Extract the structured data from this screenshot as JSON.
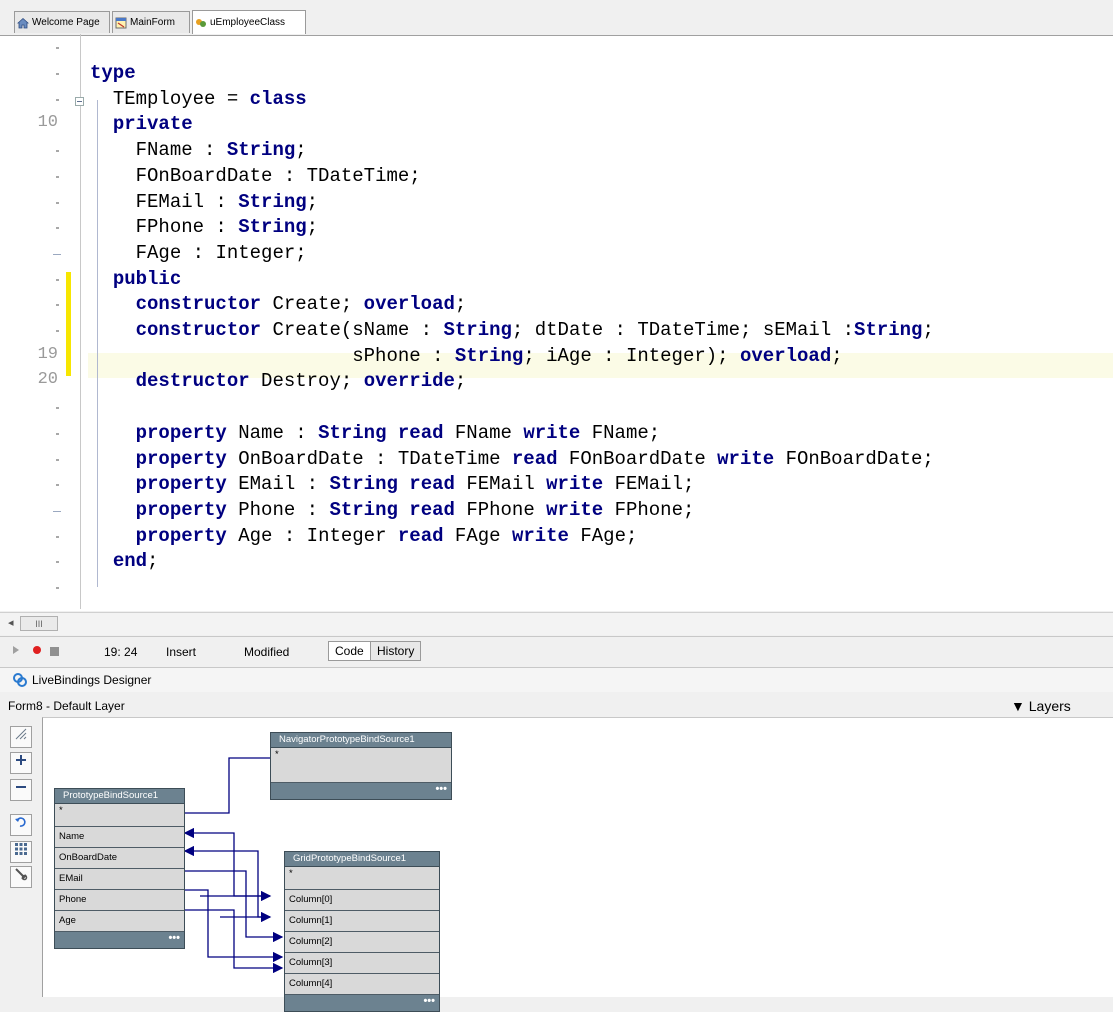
{
  "tabs": [
    {
      "label": "Welcome Page",
      "icon": "home-icon"
    },
    {
      "label": "MainForm",
      "icon": "form-icon"
    },
    {
      "label": "uEmployeeClass",
      "icon": "unit-icon"
    }
  ],
  "editor": {
    "line_numbers": [
      "10",
      "19",
      "20"
    ],
    "code_lines": [
      "type",
      "  TEmployee = class",
      "  private",
      "    FName : String;",
      "    FOnBoardDate : TDateTime;",
      "    FEMail : String;",
      "    FPhone : String;",
      "    FAge : Integer;",
      "  public",
      "    constructor Create; overload;",
      "    constructor Create(sName : String; dtDate : TDateTime; sEMail :String;",
      "                       sPhone : String; iAge : Integer); overload;",
      "    destructor Destroy; override;",
      "",
      "    property Name : String read FName write FName;",
      "    property OnBoardDate : TDateTime read FOnBoardDate write FOnBoardDate;",
      "    property EMail : String read FEMail write FEMail;",
      "    property Phone : String read FPhone write FPhone;",
      "    property Age : Integer read FAge write FAge;",
      "  end;"
    ],
    "keywords": [
      "type",
      "class",
      "private",
      "String",
      "public",
      "constructor",
      "overload",
      "destructor",
      "override",
      "property",
      "read",
      "write",
      "end"
    ],
    "scroll_thumb": "III"
  },
  "statusbar": {
    "position": "19: 24",
    "mode": "Insert",
    "state": "Modified",
    "tab_code": "Code",
    "tab_history": "History"
  },
  "livebindings": {
    "title": "LiveBindings Designer",
    "layer_label": "Form8  - Default Layer",
    "layers_button": "▼ Layers"
  },
  "tools": [
    "zoom-fit-icon",
    "zoom-in-icon",
    "zoom-out-icon",
    "undo-icon",
    "grid-icon",
    "wrench-icon"
  ],
  "bind_sources": {
    "navigator": {
      "title": "NavigatorPrototypeBindSource1",
      "rows": [
        "*"
      ],
      "footer": "•••"
    },
    "prototype": {
      "title": "PrototypeBindSource1",
      "rows": [
        "*",
        "Name",
        "OnBoardDate",
        "EMail",
        "Phone",
        "Age"
      ],
      "footer": "•••"
    },
    "grid": {
      "title": "GridPrototypeBindSource1",
      "rows": [
        "*",
        "Column[0]",
        "Column[1]",
        "Column[2]",
        "Column[3]",
        "Column[4]"
      ],
      "footer": "•••"
    }
  }
}
